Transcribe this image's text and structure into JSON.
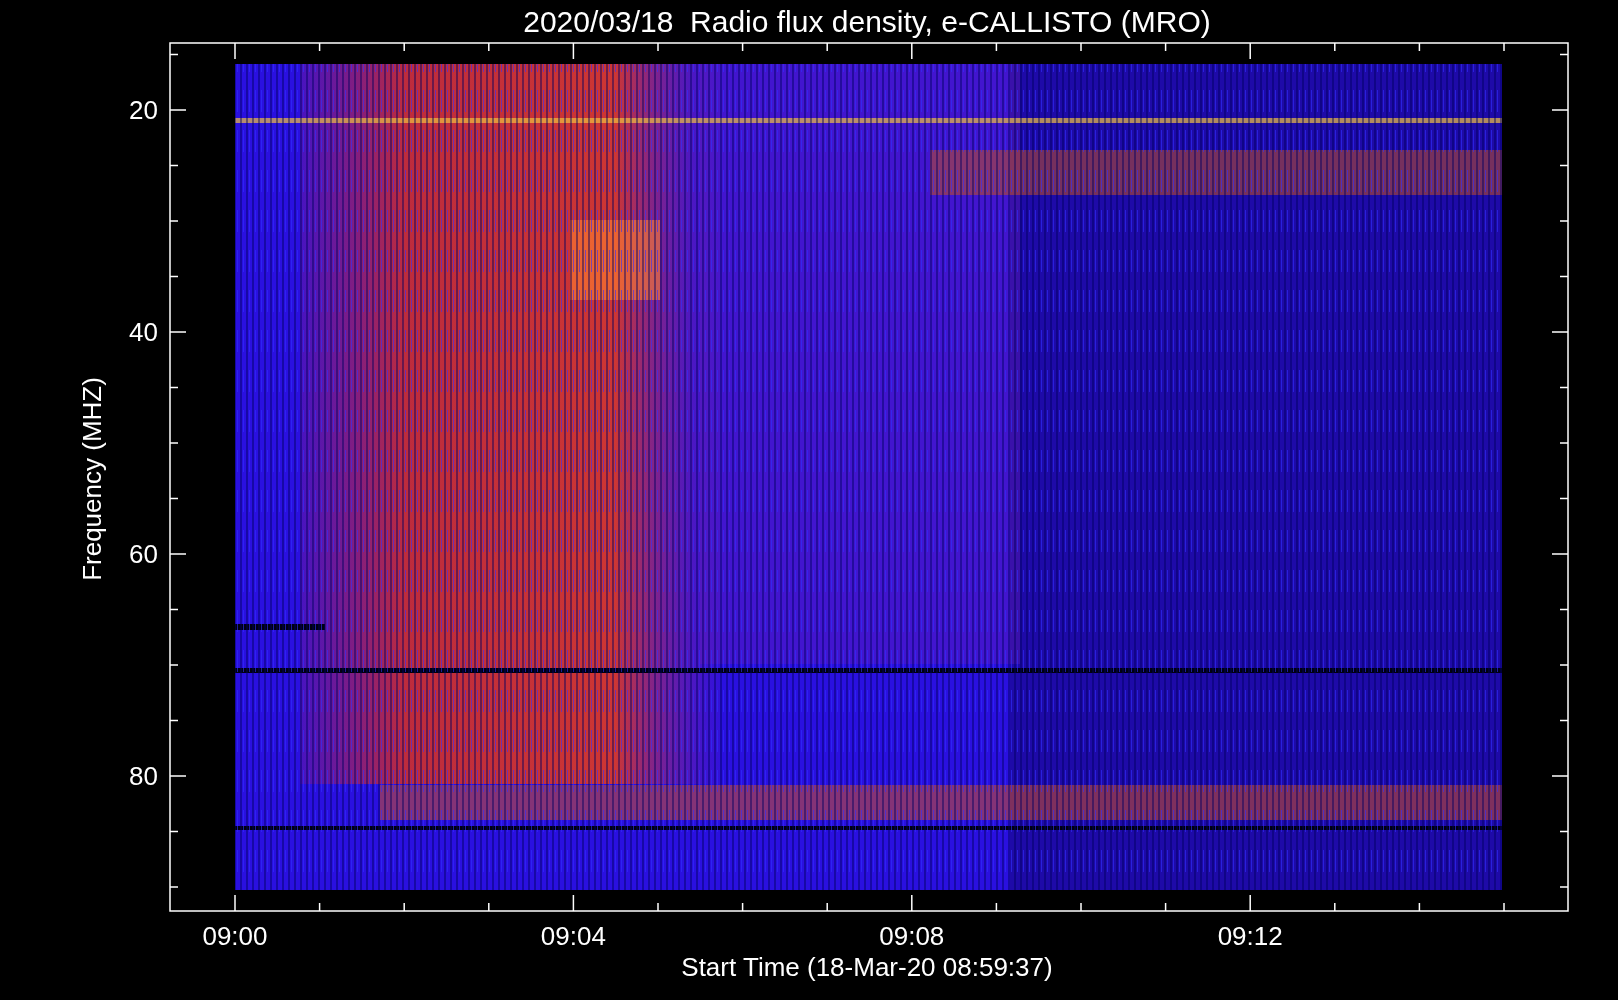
{
  "title": "2020/03/18  Radio flux density, e-CALLISTO (MRO)",
  "y_axis": {
    "label": "Frequency (MHZ)",
    "ticks": [
      "20",
      "40",
      "60",
      "80"
    ]
  },
  "x_axis": {
    "label": "Start Time (18-Mar-20 08:59:37)",
    "ticks": [
      "09:00",
      "09:04",
      "09:08",
      "09:12"
    ]
  }
}
